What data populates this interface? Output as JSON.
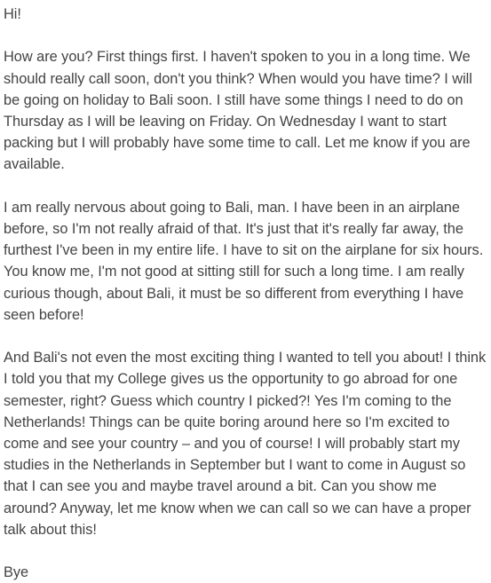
{
  "letter": {
    "greeting": "Hi!",
    "paragraphs": [
      "How are you? First things first. I haven't spoken to you in a long time. We should really call soon, don't you think? When would you have time? I will be going on holiday to Bali soon. I still have some things I need to do on Thursday as I will be leaving on Friday. On Wednesday I want to start packing but I will probably have some time to call. Let me know if you are available.",
      "I am really nervous about going to Bali, man. I have been in an airplane before, so I'm not really afraid of that. It's just that it's really far away, the furthest I've been in my entire life. I have to sit on the airplane for six hours. You know me, I'm not good at sitting still for such a long time. I am really curious though, about Bali, it must be so different from everything I have seen before!",
      "And Bali's not even the most exciting thing I wanted to tell you about! I think I told you that my College gives us the opportunity to go abroad for one semester, right? Guess which country I picked?! Yes I'm coming to the Netherlands! Things can be quite boring around here so I'm excited to come and see your country – and you of course! I will probably start my studies in the Netherlands in September but I want to come in August so that I can see you and maybe travel around a bit. Can you show me around? Anyway, let me know when we can call so we can have a proper talk about this!"
    ],
    "closing": "Bye"
  }
}
